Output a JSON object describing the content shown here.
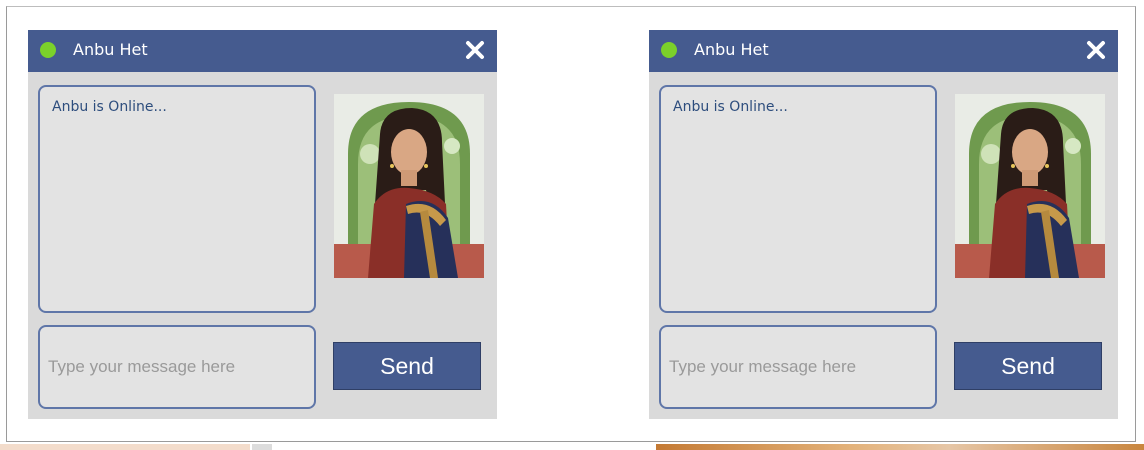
{
  "chat_windows": [
    {
      "contact_name": "Anbu Het",
      "status_message": "Anbu is Online...",
      "input": {
        "placeholder": "Type your message here",
        "value": ""
      },
      "send_label": "Send"
    },
    {
      "contact_name": "Anbu Het",
      "status_message": "Anbu is Online...",
      "input": {
        "placeholder": "Type your message here",
        "value": ""
      },
      "send_label": "Send"
    }
  ],
  "colors": {
    "header": "#455b8f",
    "online_dot": "#7bd12a",
    "panel_bg": "#dadada",
    "border_accent": "#5f76a8",
    "message_text": "#2d4d7d"
  },
  "icons": {
    "status": "online-dot",
    "close": "close-icon"
  }
}
